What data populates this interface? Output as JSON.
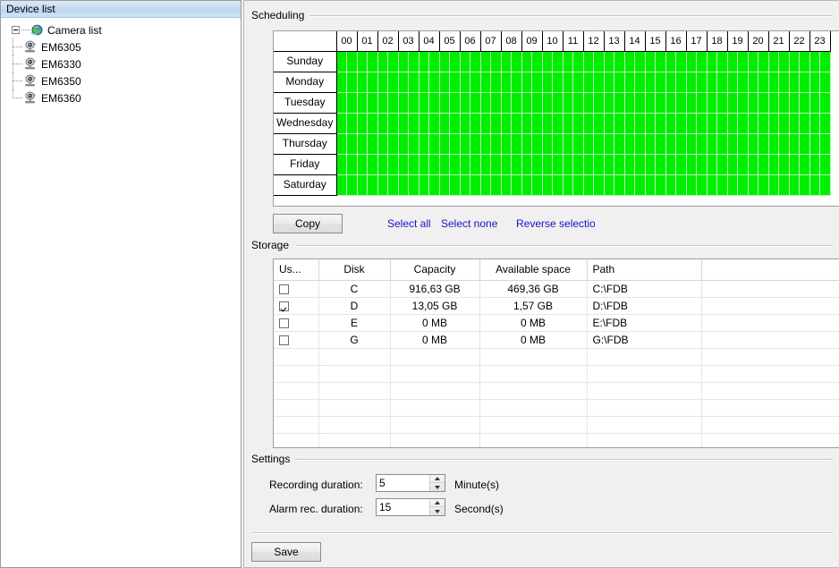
{
  "device_tree": {
    "header": "Device list",
    "root": {
      "label": "Camera list",
      "icon": "globe-icon",
      "expanded": true
    },
    "devices": [
      {
        "label": "EM6305",
        "icon": "camera-icon"
      },
      {
        "label": "EM6330",
        "icon": "camera-icon"
      },
      {
        "label": "EM6350",
        "icon": "camera-icon"
      },
      {
        "label": "EM6360",
        "icon": "camera-icon"
      }
    ]
  },
  "scheduling": {
    "title": "Scheduling",
    "hours": [
      "00",
      "01",
      "02",
      "03",
      "04",
      "05",
      "06",
      "07",
      "08",
      "09",
      "10",
      "11",
      "12",
      "13",
      "14",
      "15",
      "16",
      "17",
      "18",
      "19",
      "20",
      "21",
      "22",
      "23"
    ],
    "days": [
      "Sunday",
      "Monday",
      "Tuesday",
      "Wednesday",
      "Thursday",
      "Friday",
      "Saturday"
    ],
    "slots_per_hour": 2,
    "all_selected": true,
    "selected_color": "#00ee00",
    "copy_button": "Copy",
    "links": {
      "select_all": "Select all",
      "select_none": "Select none",
      "reverse_selection": "Reverse selection"
    }
  },
  "storage": {
    "title": "Storage",
    "columns": [
      "Us...",
      "Disk",
      "Capacity",
      "Available space",
      "Path",
      ""
    ],
    "rows": [
      {
        "use": false,
        "disk": "C",
        "capacity": "916,63 GB",
        "available": "469,36 GB",
        "path": "C:\\FDB"
      },
      {
        "use": true,
        "disk": "D",
        "capacity": "13,05 GB",
        "available": "1,57 GB",
        "path": "D:\\FDB"
      },
      {
        "use": false,
        "disk": "E",
        "capacity": "0 MB",
        "available": "0 MB",
        "path": "E:\\FDB"
      },
      {
        "use": false,
        "disk": "G",
        "capacity": "0 MB",
        "available": "0 MB",
        "path": "G:\\FDB"
      }
    ],
    "empty_rows": 8
  },
  "settings": {
    "title": "Settings",
    "recording_duration": {
      "label": "Recording duration:",
      "value": "5",
      "unit": "Minute(s)"
    },
    "alarm_rec_duration": {
      "label": "Alarm rec. duration:",
      "value": "15",
      "unit": "Second(s)"
    }
  },
  "footer": {
    "save_button": "Save"
  },
  "colors": {
    "link": "#1414c8",
    "schedule_selected": "#00ee00",
    "panel_bg": "#f0f0f0",
    "tree_header": "#c6dcf2"
  }
}
